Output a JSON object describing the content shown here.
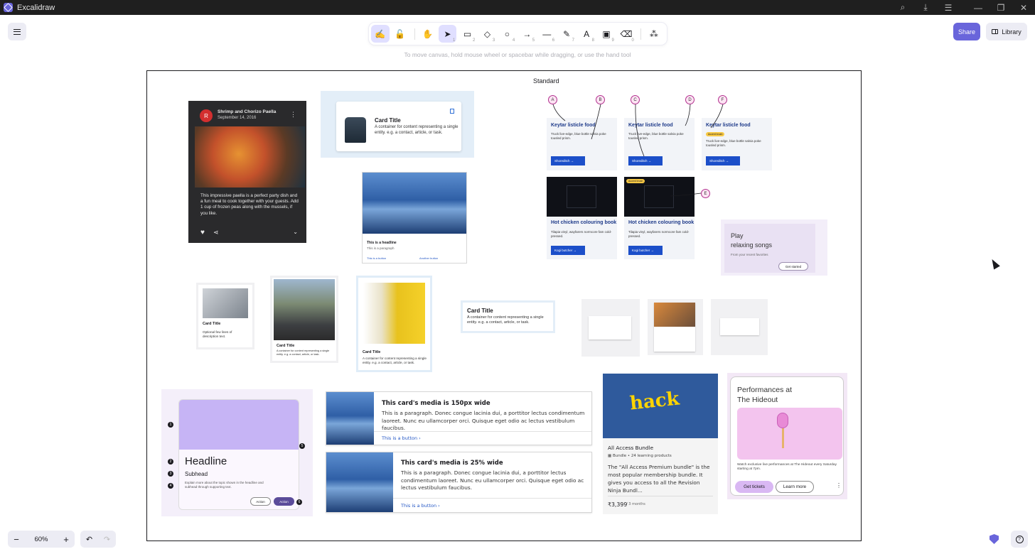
{
  "window": {
    "title": "Excalidraw"
  },
  "toolbar": {
    "tools": [
      {
        "name": "lock",
        "glyph": "🔓",
        "key": ""
      },
      {
        "name": "hand",
        "glyph": "✋",
        "key": ""
      },
      {
        "name": "selection",
        "glyph": "➤",
        "key": "1"
      },
      {
        "name": "rectangle",
        "glyph": "▭",
        "key": "2"
      },
      {
        "name": "diamond",
        "glyph": "◇",
        "key": "3"
      },
      {
        "name": "ellipse",
        "glyph": "○",
        "key": "4"
      },
      {
        "name": "arrow",
        "glyph": "→",
        "key": "5"
      },
      {
        "name": "line",
        "glyph": "—",
        "key": "6"
      },
      {
        "name": "draw",
        "glyph": "✎",
        "key": "7"
      },
      {
        "name": "text",
        "glyph": "A",
        "key": "8"
      },
      {
        "name": "image",
        "glyph": "▣",
        "key": "9"
      },
      {
        "name": "eraser",
        "glyph": "⌫",
        "key": "0"
      },
      {
        "name": "extra-tools",
        "glyph": "⁂",
        "key": ""
      }
    ],
    "hint": "To move canvas, hold mouse wheel or spacebar while dragging, or use the hand tool"
  },
  "header": {
    "share_label": "Share",
    "library_label": "Library"
  },
  "frame": {
    "label": "Standard"
  },
  "footer": {
    "zoom": "60%"
  },
  "cards": {
    "paella": {
      "avatar": "R",
      "title": "Shrimp and Chorizo Paella",
      "date": "September 14, 2016",
      "body": "This impressive paella is a perfect party dish and a fun meal to cook together with your guests. Add 1 cup of frozen peas along with the mussels, if you like."
    },
    "jacket": {
      "title": "Card Title",
      "desc": "A container for content representing a single entity. e.g. a contact, article, or task."
    },
    "mountain": {
      "headline": "This is a headline",
      "para": "This is a paragraph",
      "link1": "This is a button",
      "link2": "Another button"
    },
    "eyebrow": [
      {
        "title": "Keytar listicle food",
        "desc": "Truck live-edge, blue bottle salvia poke tousled prism.",
        "btn": "Shoreditch",
        "chip": ""
      },
      {
        "title": "Keytar listicle food",
        "desc": "Truck live-edge, blue bottle salvia poke tousled prism.",
        "btn": "Shoreditch",
        "chip": ""
      },
      {
        "title": "Keytar listicle food",
        "desc": "Truck live-edge, blue bottle salvia poke tousled prism.",
        "btn": "Shoreditch",
        "chip": "Accent brush"
      },
      {
        "title": "Hot chicken colouring book",
        "desc": "Tilapia vinyl, wayfarers normcore fam cold-pressed.",
        "btn": "Kogi butcher",
        "chip": ""
      },
      {
        "title": "Hot chicken colouring book",
        "desc": "Tilapia vinyl, wayfarers normcore fam cold-pressed.",
        "btn": "Kogi butcher",
        "chip": "Accent brush"
      }
    ],
    "callouts": [
      "A",
      "B",
      "C",
      "D",
      "F",
      "E",
      "1"
    ],
    "play": {
      "line1": "Play",
      "line2": "relaxing songs",
      "sub": "From your recent favorites",
      "btn": "Get started"
    },
    "laptop": {
      "title": "Card Title",
      "desc": "Optional few lines of description text."
    },
    "cyclists": {
      "title": "Card Title",
      "desc": "A container for content representing a single entity. e.g. a contact, article, or task."
    },
    "woman": {
      "title": "Card Title",
      "desc": "A container for content representing a single entity. e.g. a contact, article, or task."
    },
    "text_card": {
      "title": "Card Title",
      "desc": "A container for content representing a single entity. e.g. a contact, article, or task."
    },
    "m3": {
      "headline": "Headline",
      "subhead": "Subhead",
      "support": "Explain more about the topic shown in the headline and subhead through supporting text.",
      "action1": "Action",
      "action2": "Action",
      "nums": [
        "1",
        "2",
        "3",
        "4",
        "5",
        "6"
      ]
    },
    "h1": {
      "title": "This card's media is 150px wide",
      "para": "This is a paragraph. Donec congue lacinia dui, a porttitor lectus condimentum laoreet. Nunc eu ullamcorper orci. Quisque eget odio ac lectus vestibulum faucibus.",
      "button": "This is a button"
    },
    "h2": {
      "title": "This card's media is 25% wide",
      "para": "This is a paragraph. Donec congue lacinia dui, a porttitor lectus condimentum laoreet. Nunc eu ullamcorper orci. Quisque eget odio ac lectus vestibulum faucibus.",
      "button": "This is a button"
    },
    "hack": {
      "word": "hack",
      "title": "All Access Bundle",
      "meta": "Bundle • 24 learning products",
      "desc": "The \"All Access Premium bundle\" is the most popular membership bundle. It gives you access to all the Revision Ninja Bundl...",
      "price": "₹3,399",
      "period": "/ 3 months"
    },
    "perf": {
      "line1": "Performances at",
      "line2": "The Hideout",
      "desc": "Watch exclusive live performances at The Hideout every Saturday starting at 7pm.",
      "btn1": "Get tickets",
      "btn2": "Learn more"
    }
  }
}
